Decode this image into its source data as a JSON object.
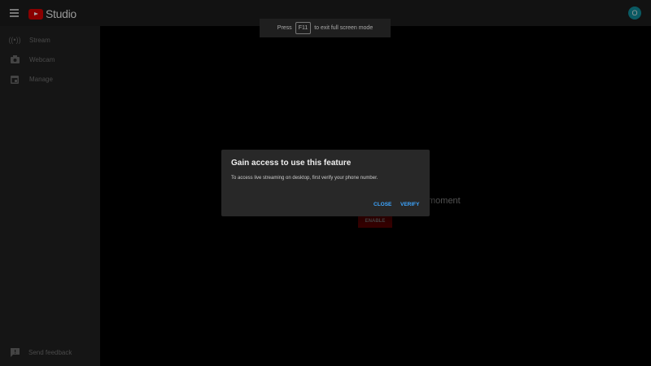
{
  "header": {
    "app_name": "Studio",
    "avatar_initial": "O"
  },
  "sidebar": {
    "items": [
      {
        "label": "Stream",
        "icon": "stream-icon"
      },
      {
        "label": "Webcam",
        "icon": "camera-icon"
      },
      {
        "label": "Manage",
        "icon": "calendar-icon"
      }
    ],
    "feedback": "Send feedback"
  },
  "toast": {
    "before": "Press",
    "key": "F11",
    "after": "to exit full screen mode"
  },
  "background": {
    "text": "moment",
    "enable_label": "ENABLE"
  },
  "dialog": {
    "title": "Gain access to use this feature",
    "body": "To access live streaming on desktop, first verify your phone number.",
    "close_label": "CLOSE",
    "verify_label": "VERIFY"
  },
  "colors": {
    "accent": "#3ea6ff",
    "brand": "#ff0000"
  }
}
